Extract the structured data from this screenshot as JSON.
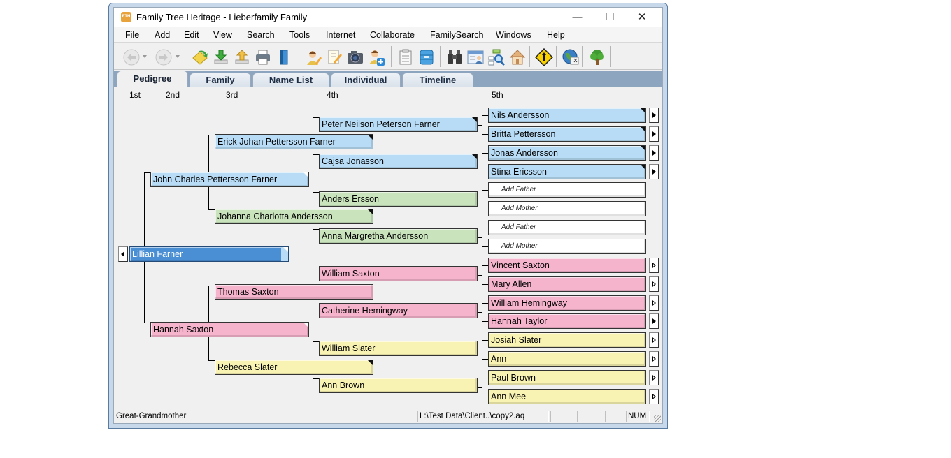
{
  "window": {
    "app_icon_text": "FTH",
    "title": "Family Tree Heritage - Lieberfamily Family",
    "controls": {
      "minimize": "—",
      "maximize": "☐",
      "close": "✕"
    }
  },
  "menu": [
    {
      "label": "File"
    },
    {
      "label": "Add"
    },
    {
      "label": "Edit"
    },
    {
      "label": "View"
    },
    {
      "label": "Search"
    },
    {
      "label": "Tools"
    },
    {
      "label": "Internet"
    },
    {
      "label": "Collaborate"
    },
    {
      "label": "FamilySearch"
    },
    {
      "label": "Windows"
    },
    {
      "label": "Help"
    }
  ],
  "toolbar": {
    "icons": [
      "back-icon",
      "forward-icon",
      "open-family-icon",
      "download-icon",
      "upload-icon",
      "print-icon",
      "book-icon",
      "edit-person-icon",
      "notes-icon",
      "camera-icon",
      "add-person-icon",
      "checklist-icon",
      "database-icon",
      "binoculars-icon",
      "person-card-icon",
      "chart-search-icon",
      "home-icon",
      "merge-sign-icon",
      "globe-icon",
      "tree-icon"
    ]
  },
  "tabs": [
    {
      "label": "Pedigree",
      "active": true
    },
    {
      "label": "Family"
    },
    {
      "label": "Name List"
    },
    {
      "label": "Individual"
    },
    {
      "label": "Timeline"
    }
  ],
  "generations": [
    "1st",
    "2nd",
    "3rd",
    "4th",
    "5th"
  ],
  "pedigree": {
    "root": {
      "name": "Lillian Farner"
    },
    "gen2": [
      {
        "name": "John Charles Pettersson Farner"
      },
      {
        "name": "Hannah Saxton"
      }
    ],
    "gen3": [
      {
        "name": "Erick Johan Pettersson Farner"
      },
      {
        "name": "Johanna Charlotta Andersson"
      },
      {
        "name": "Thomas Saxton"
      },
      {
        "name": "Rebecca Slater"
      }
    ],
    "gen4": [
      {
        "name": "Peter Neilson Peterson Farner"
      },
      {
        "name": "Cajsa Jonasson"
      },
      {
        "name": "Anders Ersson"
      },
      {
        "name": "Anna Margretha Andersson"
      },
      {
        "name": "William Saxton"
      },
      {
        "name": "Catherine Hemingway"
      },
      {
        "name": "William Slater"
      },
      {
        "name": "Ann Brown"
      }
    ],
    "gen5": [
      {
        "name": "Nils Andersson"
      },
      {
        "name": "Britta Pettersson"
      },
      {
        "name": "Jonas Andersson"
      },
      {
        "name": "Stina Ericsson"
      },
      {
        "name": "Add Father"
      },
      {
        "name": "Add Mother"
      },
      {
        "name": "Add Father"
      },
      {
        "name": "Add Mother"
      },
      {
        "name": "Vincent Saxton"
      },
      {
        "name": "Mary Allen"
      },
      {
        "name": "William Hemingway"
      },
      {
        "name": "Hannah Taylor"
      },
      {
        "name": "Josiah Slater"
      },
      {
        "name": "Ann"
      },
      {
        "name": "Paul Brown"
      },
      {
        "name": "Ann Mee"
      }
    ]
  },
  "colors": {
    "paternal_paternal": "#b8dcf5",
    "paternal_maternal": "#c9e3bc",
    "maternal_paternal": "#f5b3cc",
    "maternal_maternal": "#f9f3b3",
    "selected": "#4a8fd4"
  },
  "status": {
    "relationship": "Great-Grandmother",
    "file_path": "L:\\Test Data\\Client..\\copy2.aq",
    "num": "NUM"
  }
}
